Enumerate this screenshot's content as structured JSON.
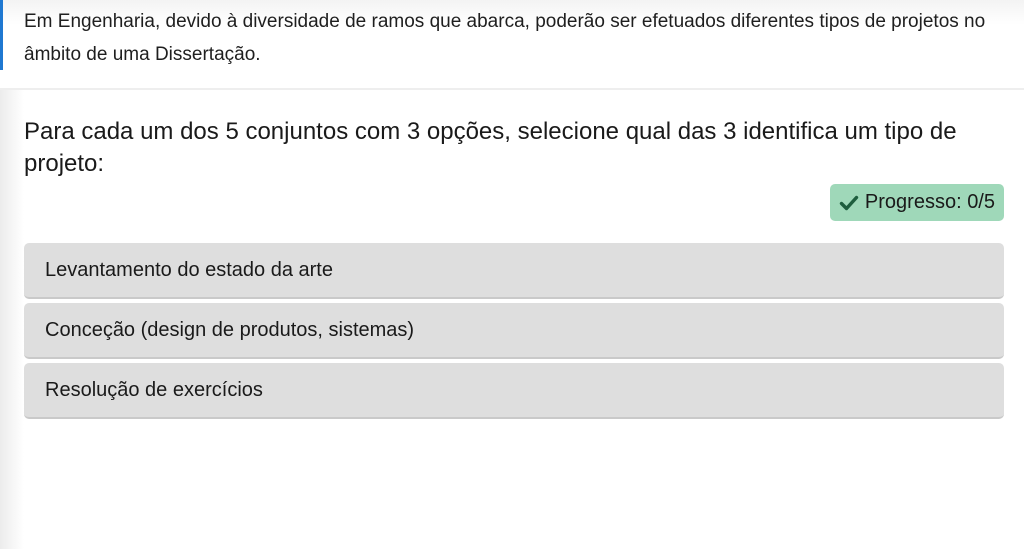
{
  "intro": {
    "text": "Em Engenharia, devido à diversidade de ramos que abarca, poderão ser efetuados diferentes tipos de projetos no âmbito de uma Dissertação."
  },
  "question": {
    "text": "Para cada um dos 5 conjuntos com 3 opções, selecione qual das 3 identifica um tipo de projeto:"
  },
  "progress": {
    "icon": "check-icon",
    "label": "Progresso: 0/5",
    "color": "#9fd8b9"
  },
  "options": [
    {
      "label": "Levantamento do estado da arte"
    },
    {
      "label": "Conceção (design de produtos, sistemas)"
    },
    {
      "label": "Resolução de exercícios"
    }
  ],
  "colors": {
    "accent": "#1f78d1",
    "option_bg": "#dedede"
  }
}
